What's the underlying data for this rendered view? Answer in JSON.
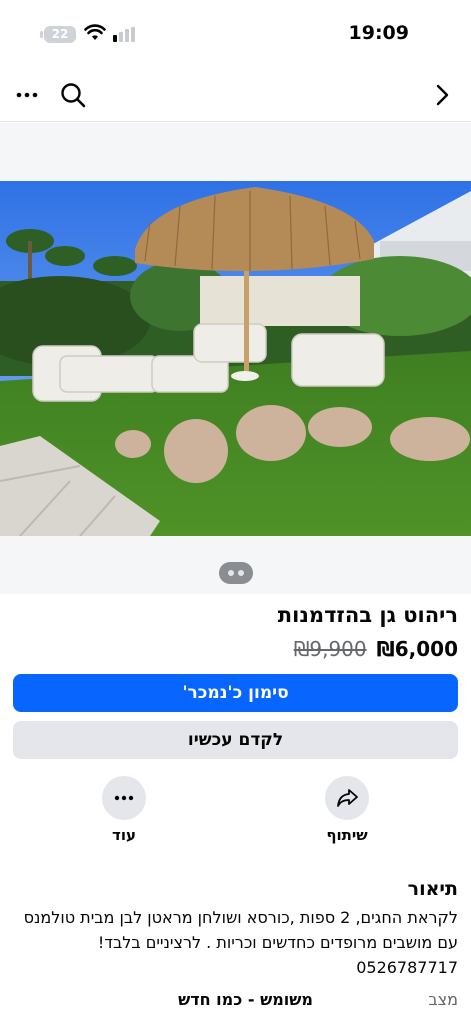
{
  "status_bar": {
    "time": "19:09",
    "battery": "22"
  },
  "listing": {
    "title": "ריהוט גן בהזדמנות",
    "price": "₪6,000",
    "old_price": "₪9,900"
  },
  "buttons": {
    "primary": "סימון כ'נמכר'",
    "secondary": "לקדם עכשיו"
  },
  "actions": {
    "share": "שיתוף",
    "more": "עוד"
  },
  "description": {
    "title": "תיאור",
    "text": "לקראת החגים, 2 ספות ,כורסא ושולחן מראטן לבן מבית טולמנס עם מושבים מרופדים כחדשים וכריות . לרציניים בלבד! 0526787717"
  },
  "details": {
    "condition_label": "מצב",
    "condition_value": "משומש - כמו חדש"
  },
  "icons": [
    "wifi-icon",
    "signal-icon",
    "more-icon",
    "search-icon",
    "back-chevron-icon",
    "share-icon",
    "more-dots-icon"
  ],
  "colors": {
    "primary": "#0866ff",
    "secondary_bg": "#e4e6eb",
    "muted_text": "#65676b"
  }
}
